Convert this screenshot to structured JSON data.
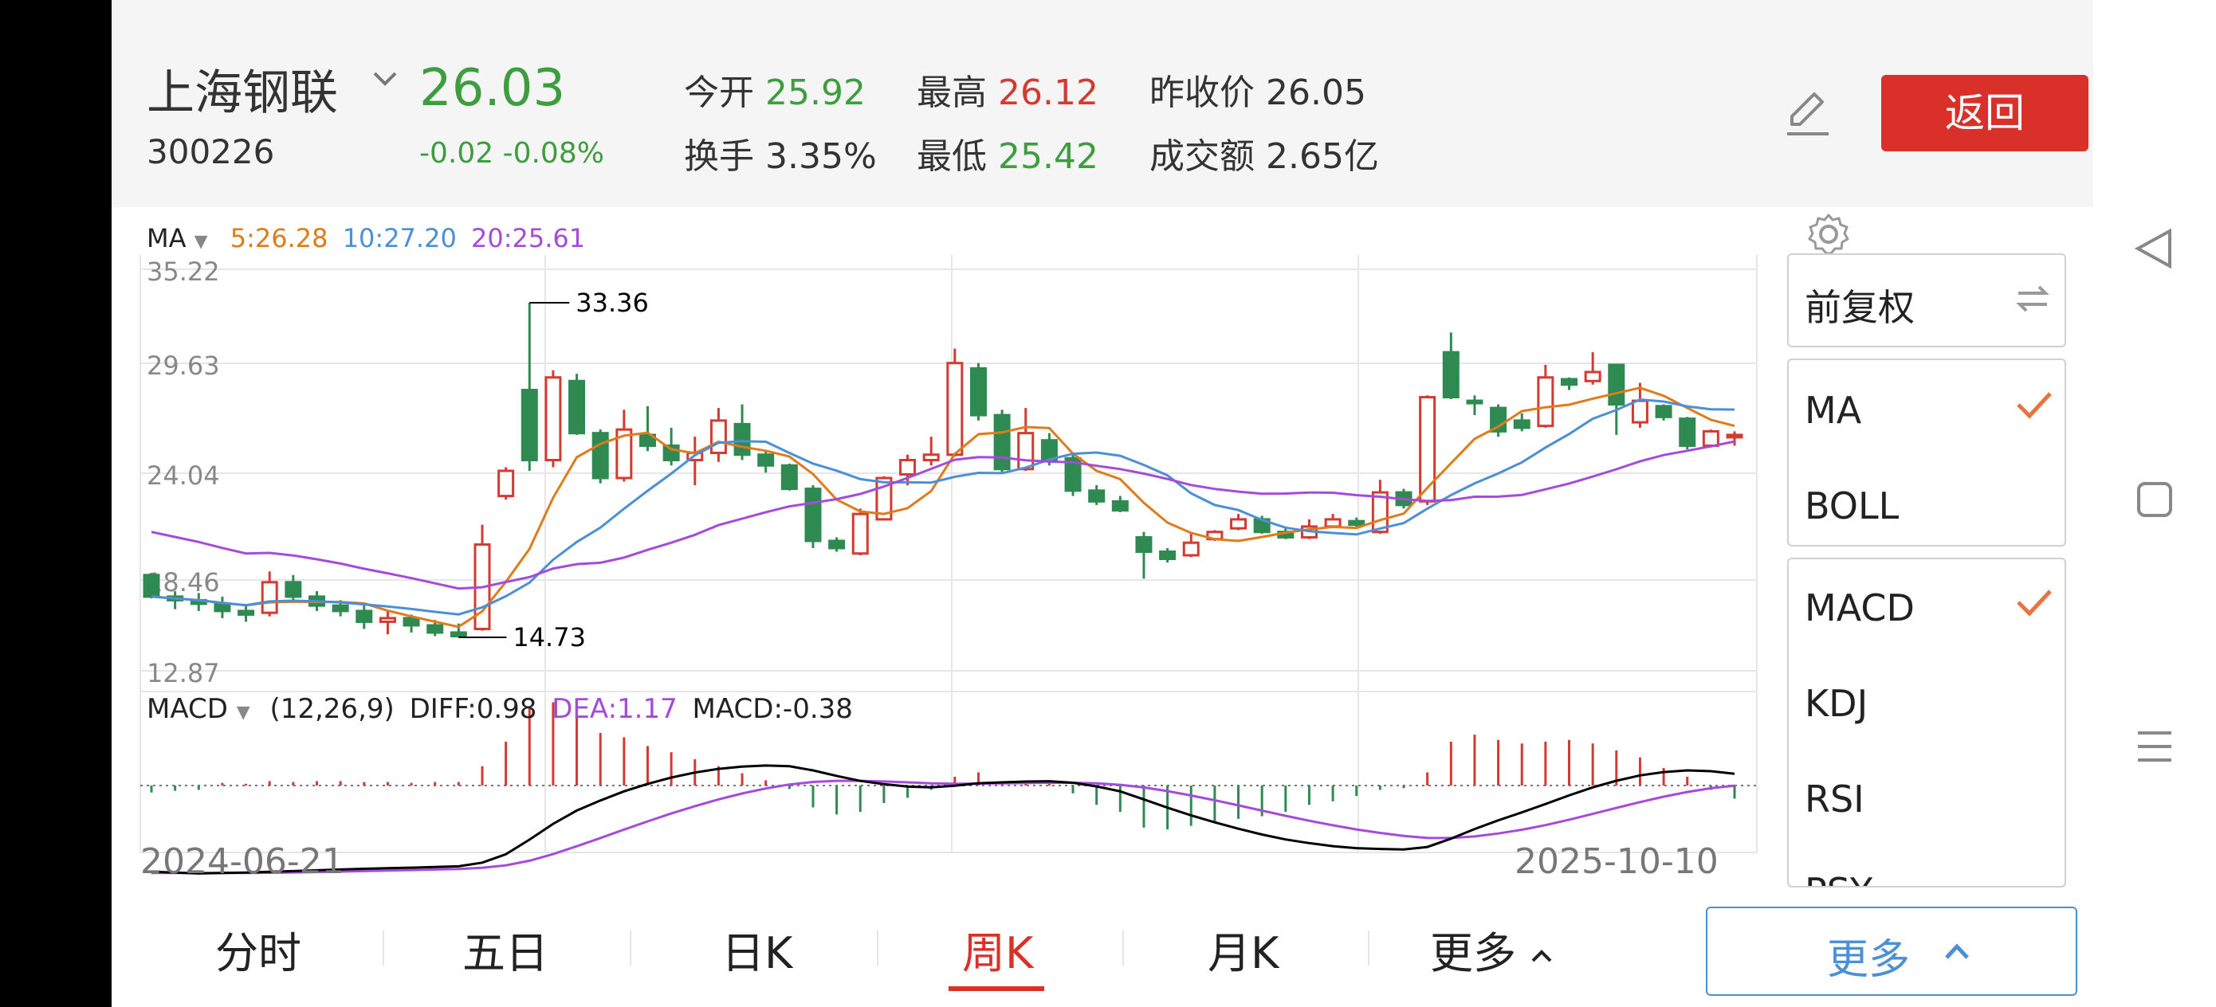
{
  "stock": {
    "name": "上海钢联",
    "code": "300226",
    "price": "26.03",
    "change": "-0.02 -0.08%",
    "open_label": "今开",
    "open_value": "25.92",
    "high_label": "最高",
    "high_value": "26.12",
    "prev_label": "昨收价",
    "prev_value": "26.05",
    "turnover_label": "换手",
    "turnover_value": "3.35%",
    "low_label": "最低",
    "low_value": "25.42",
    "amount_label": "成交额",
    "amount_value": "2.65亿"
  },
  "header": {
    "back_label": "返回"
  },
  "colors": {
    "up": "#d33a32",
    "down": "#2f8a52",
    "ma5": "#e07b1c",
    "ma10": "#4b8fd6",
    "ma20": "#a54bdb",
    "accent": "#d9302a"
  },
  "chart_legend": {
    "ma_label": "MA",
    "ma5": "5:26.28",
    "ma10": "10:27.20",
    "ma20": "20:25.61",
    "macd_label": "MACD",
    "macd_params": "(12,26,9)",
    "diff": "DIFF:0.98",
    "dea": "DEA:1.17",
    "macd": "MACD:-0.38"
  },
  "chart_data": {
    "type": "candlestick",
    "price_axis": {
      "ticks": [
        "35.22",
        "29.63",
        "24.04",
        "18.46",
        "12.87"
      ],
      "ylim": [
        12.87,
        35.22
      ]
    },
    "x_labels": {
      "start": "2024-06-21",
      "end": "2025-10-10"
    },
    "annotations": {
      "high": "33.36",
      "low": "14.73"
    },
    "candles": [
      [
        18.2,
        17.0,
        18.3,
        16.9
      ],
      [
        17.0,
        16.8,
        17.3,
        16.3
      ],
      [
        16.8,
        16.6,
        17.2,
        16.2
      ],
      [
        16.6,
        16.2,
        17.0,
        15.8
      ],
      [
        16.2,
        16.0,
        16.6,
        15.6
      ],
      [
        16.1,
        17.8,
        18.4,
        15.9
      ],
      [
        17.8,
        17.0,
        18.2,
        16.8
      ],
      [
        17.0,
        16.5,
        17.3,
        16.2
      ],
      [
        16.5,
        16.2,
        16.8,
        15.9
      ],
      [
        16.2,
        15.6,
        16.5,
        15.2
      ],
      [
        15.6,
        15.8,
        16.2,
        14.9
      ],
      [
        15.8,
        15.4,
        16.0,
        15.0
      ],
      [
        15.4,
        15.0,
        15.7,
        14.8
      ],
      [
        15.0,
        14.8,
        15.5,
        14.73
      ],
      [
        15.2,
        19.9,
        21.0,
        15.1
      ],
      [
        22.6,
        24.0,
        24.2,
        22.4
      ],
      [
        28.5,
        24.6,
        33.36,
        24.0
      ],
      [
        24.6,
        29.2,
        29.6,
        24.2
      ],
      [
        29.0,
        26.1,
        29.4,
        26.0
      ],
      [
        26.1,
        23.6,
        26.3,
        23.3
      ],
      [
        23.6,
        26.3,
        27.4,
        23.4
      ],
      [
        26.0,
        25.4,
        27.6,
        25.1
      ],
      [
        25.4,
        24.6,
        26.4,
        24.3
      ],
      [
        24.6,
        25.0,
        25.9,
        23.2
      ],
      [
        25.0,
        26.8,
        27.5,
        24.5
      ],
      [
        26.6,
        24.9,
        27.7,
        24.6
      ],
      [
        24.9,
        24.3,
        25.1,
        23.9
      ],
      [
        24.3,
        23.0,
        24.4,
        22.9
      ],
      [
        23.0,
        20.1,
        23.2,
        19.7
      ],
      [
        20.1,
        19.7,
        20.3,
        19.5
      ],
      [
        19.4,
        21.6,
        21.9,
        19.3
      ],
      [
        21.3,
        23.6,
        23.7,
        21.3
      ],
      [
        23.8,
        24.6,
        24.9,
        23.2
      ],
      [
        24.6,
        24.9,
        25.9,
        24.3
      ],
      [
        24.9,
        30.0,
        30.8,
        24.8
      ],
      [
        29.7,
        27.1,
        30.0,
        26.8
      ],
      [
        27.1,
        24.1,
        27.4,
        23.9
      ],
      [
        24.1,
        26.1,
        27.5,
        24.0
      ],
      [
        25.7,
        24.6,
        26.1,
        24.3
      ],
      [
        24.7,
        22.9,
        25.0,
        22.6
      ],
      [
        22.9,
        22.3,
        23.2,
        22.1
      ],
      [
        22.3,
        21.8,
        22.6,
        21.7
      ],
      [
        20.3,
        19.5,
        20.6,
        18.0
      ],
      [
        19.5,
        19.1,
        19.7,
        18.9
      ],
      [
        19.3,
        20.0,
        20.5,
        19.2
      ],
      [
        20.2,
        20.6,
        20.7,
        20.1
      ],
      [
        20.8,
        21.3,
        21.6,
        20.7
      ],
      [
        21.3,
        20.6,
        21.5,
        20.5
      ],
      [
        20.6,
        20.3,
        20.9,
        20.2
      ],
      [
        20.3,
        20.9,
        21.3,
        20.2
      ],
      [
        20.9,
        21.3,
        21.6,
        20.9
      ],
      [
        21.2,
        21.0,
        21.4,
        20.9
      ],
      [
        20.6,
        22.8,
        23.5,
        20.5
      ],
      [
        22.8,
        22.1,
        23.0,
        21.9
      ],
      [
        22.3,
        28.1,
        28.2,
        22.1
      ],
      [
        30.6,
        28.1,
        31.7,
        28.0
      ],
      [
        27.9,
        27.8,
        28.2,
        27.1
      ],
      [
        27.5,
        26.2,
        27.7,
        25.9
      ],
      [
        26.8,
        26.4,
        27.2,
        26.2
      ],
      [
        26.5,
        29.2,
        29.9,
        26.4
      ],
      [
        29.1,
        28.8,
        29.2,
        28.5
      ],
      [
        29.0,
        29.5,
        30.6,
        28.8
      ],
      [
        29.9,
        27.7,
        29.9,
        26.0
      ],
      [
        26.7,
        27.9,
        28.9,
        26.4
      ],
      [
        27.6,
        27.0,
        27.7,
        26.8
      ],
      [
        26.9,
        25.4,
        27.0,
        25.2
      ],
      [
        25.4,
        26.2,
        26.3,
        25.3
      ],
      [
        25.9,
        26.0,
        26.2,
        25.4
      ]
    ],
    "macd_hist": [
      -0.08,
      -0.06,
      -0.05,
      0.03,
      0.02,
      0.05,
      0.04,
      0.05,
      0.05,
      0.04,
      0.04,
      0.03,
      0.04,
      0.04,
      0.22,
      0.5,
      0.88,
      0.95,
      0.8,
      0.6,
      0.55,
      0.45,
      0.38,
      0.3,
      0.22,
      0.14,
      0.06,
      -0.04,
      -0.25,
      -0.33,
      -0.3,
      -0.2,
      -0.14,
      -0.05,
      0.1,
      0.15,
      0.05,
      0.05,
      0.02,
      -0.09,
      -0.22,
      -0.3,
      -0.48,
      -0.5,
      -0.46,
      -0.42,
      -0.38,
      -0.35,
      -0.3,
      -0.22,
      -0.18,
      -0.12,
      -0.05,
      -0.03,
      0.15,
      0.5,
      0.58,
      0.52,
      0.48,
      0.5,
      0.52,
      0.48,
      0.4,
      0.32,
      0.2,
      0.1,
      -0.05,
      -0.15
    ]
  },
  "period_tabs": [
    "分时",
    "五日",
    "日K",
    "周K",
    "月K",
    "更多"
  ],
  "active_tab": "周K",
  "side_panel": {
    "adjust": "前复权",
    "main_indicators": [
      "MA",
      "BOLL"
    ],
    "sub_indicators": [
      "MACD",
      "KDJ",
      "RSI",
      "PSY"
    ],
    "more_label": "更多"
  }
}
